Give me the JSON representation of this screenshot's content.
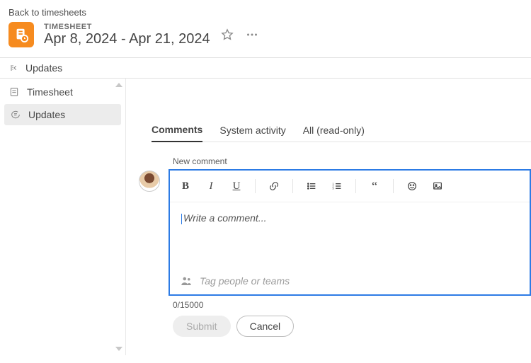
{
  "back_link": "Back to timesheets",
  "header": {
    "kicker": "TIMESHEET",
    "range": "Apr 8, 2024 - Apr 21, 2024"
  },
  "breadcrumb": "Updates",
  "sidebar": {
    "items": [
      {
        "label": "Timesheet"
      },
      {
        "label": "Updates"
      }
    ]
  },
  "tabs": [
    {
      "label": "Comments"
    },
    {
      "label": "System activity"
    },
    {
      "label": "All (read-only)"
    }
  ],
  "composer": {
    "heading": "New comment",
    "placeholder": "Write a comment...",
    "tag_placeholder": "Tag people or teams",
    "counter": "0/15000",
    "submit": "Submit",
    "cancel": "Cancel"
  }
}
